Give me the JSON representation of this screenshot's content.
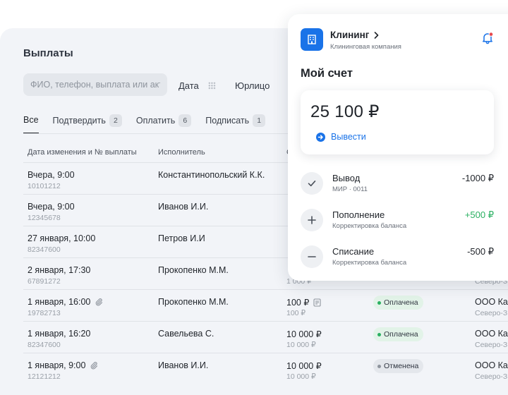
{
  "payouts": {
    "title": "Выплаты",
    "search_placeholder": "ФИО, телефон, выплата или акт",
    "filters": {
      "date": "Дата",
      "entity": "Юрлицо"
    },
    "tabs": [
      {
        "label": "Все",
        "count": ""
      },
      {
        "label": "Подтвердить",
        "count": "2"
      },
      {
        "label": "Оплатить",
        "count": "6"
      },
      {
        "label": "Подписать",
        "count": "1"
      }
    ],
    "columns": {
      "date": "Дата изменения и № выплаты",
      "executor": "Исполнитель",
      "amount": "С"
    },
    "rows": [
      {
        "date": "Вчера, 9:00",
        "id": "10101212",
        "executor": "Константинопольский К.К.",
        "amount": "",
        "amount_sub": "",
        "status": "",
        "org": "",
        "city": ""
      },
      {
        "date": "Вчера, 9:00",
        "id": "12345678",
        "executor": "Иванов И.И.",
        "amount": "",
        "amount_sub": "",
        "status": "",
        "org": "",
        "city": ""
      },
      {
        "date": "27 января, 10:00",
        "id": "82347600",
        "executor": "Петров И.И",
        "amount": "",
        "amount_sub": "",
        "status": "",
        "org": "",
        "city": ""
      },
      {
        "date": "2 января, 17:30",
        "id": "67891272",
        "executor": "Прокопенко М.М.",
        "amount": "",
        "amount_sub": "1 000 ₽",
        "status": "",
        "org": "",
        "city": "Северо-З"
      },
      {
        "date": "1 января, 16:00",
        "id": "19782713",
        "executor": "Прокопенко М.М.",
        "amount": "100 ₽",
        "amount_sub": "100 ₽",
        "status": "Оплачена",
        "status_color": "#2ab061",
        "status_bg": "#e2f3e8",
        "org": "ООО Ка",
        "city": "Северо-З",
        "clip": true,
        "doc": true
      },
      {
        "date": "1 января, 16:20",
        "id": "82347600",
        "executor": "Савельева С.",
        "amount": "10 000 ₽",
        "amount_sub": "10 000 ₽",
        "status": "Оплачена",
        "status_color": "#2ab061",
        "status_bg": "#e2f3e8",
        "org": "ООО Ка",
        "city": "Северо-З"
      },
      {
        "date": "1 января, 9:00",
        "id": "12121212",
        "executor": "Иванов И.И.",
        "amount": "10 000 ₽",
        "amount_sub": "10 000 ₽",
        "status": "Отменена",
        "status_color": "#8e949d",
        "status_bg": "#e4e7ec",
        "org": "ООО Ка",
        "city": "Северо-З",
        "clip": true
      }
    ]
  },
  "account": {
    "company_name": "Клининг",
    "company_sub": "Клининговая компания",
    "title": "Мой счет",
    "balance": "25 100 ₽",
    "withdraw_label": "Вывести",
    "transactions": [
      {
        "icon": "check-icon",
        "title": "Вывод",
        "sub": "МИР · 0011",
        "amount": "-1000 ₽",
        "amount_color": "#1f2329"
      },
      {
        "icon": "plus-icon",
        "title": "Пополнение",
        "sub": "Корректировка баланса",
        "amount": "+500 ₽",
        "amount_color": "#2ab061"
      },
      {
        "icon": "minus-icon",
        "title": "Списание",
        "sub": "Корректировка баланса",
        "amount": "-500 ₽",
        "amount_color": "#1f2329"
      }
    ]
  },
  "colors": {
    "accent": "#1a73e8",
    "positive": "#2ab061",
    "notification": "#e5484d"
  }
}
